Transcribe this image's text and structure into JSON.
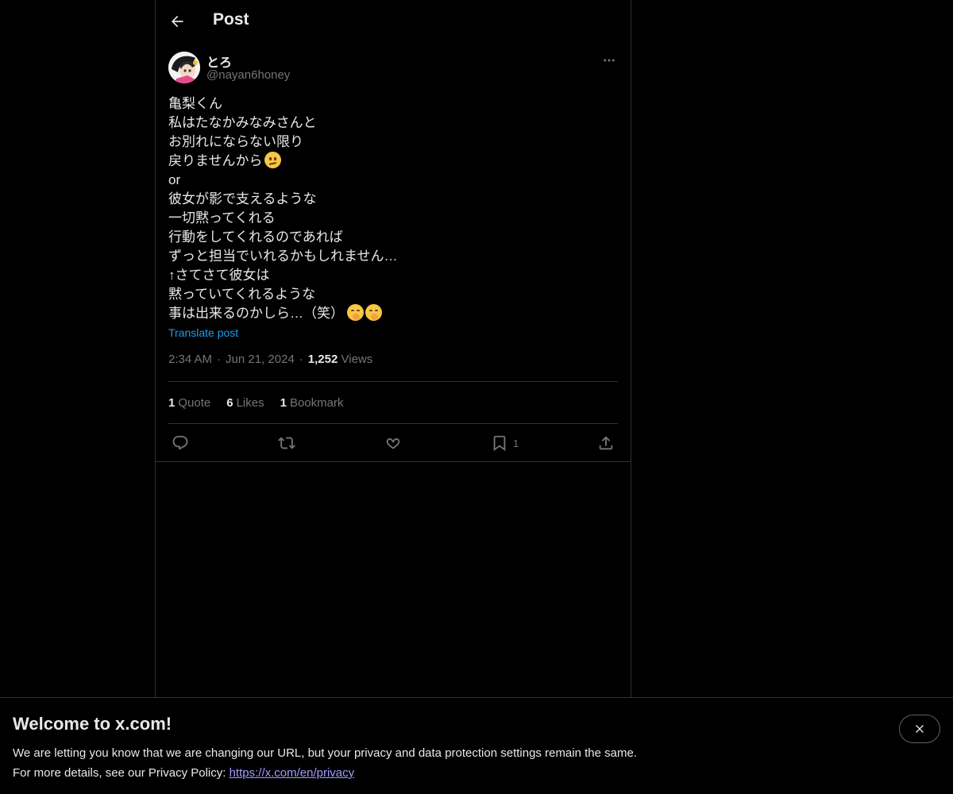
{
  "header": {
    "title": "Post"
  },
  "tweet": {
    "author": {
      "display_name": "とろ",
      "handle": "@nayan6honey"
    },
    "lines": [
      "亀梨くん",
      "私はたなかみなみさんと",
      "お別れにならない限り",
      "戻りませんから",
      "or",
      "彼女が影で支えるような",
      "一切黙ってくれる",
      "行動をしてくれるのであれば",
      "ずっと担当でいれるかもしれません…",
      "↑さてさて彼女は",
      "黙っていてくれるような",
      "事は出来るのかしら…（笑）"
    ],
    "emojis": [
      "face-with-diagonal-mouth",
      "face-with-hand-over-mouth",
      "face-with-hand-over-mouth"
    ],
    "translate_label": "Translate post",
    "time": "2:34 AM",
    "date": "Jun 21, 2024",
    "views_count": "1,252",
    "views_label": "Views",
    "stats": {
      "quotes_count": "1",
      "quotes_label": "Quote",
      "likes_count": "6",
      "likes_label": "Likes",
      "bookmarks_count": "1",
      "bookmarks_label": "Bookmark"
    },
    "actions": {
      "bookmark_count": "1"
    }
  },
  "banner": {
    "title": "Welcome to x.com!",
    "line1": "We are letting you know that we are changing our URL, but your privacy and data protection settings remain the same.",
    "line2_prefix": "For more details, see our Privacy Policy: ",
    "link": "https://x.com/en/privacy"
  },
  "colors": {
    "background": "#000000",
    "text": "#e7e9ea",
    "muted": "#71767b",
    "accent": "#1d9bf0",
    "link": "#a29bff",
    "border": "#2f3336"
  }
}
